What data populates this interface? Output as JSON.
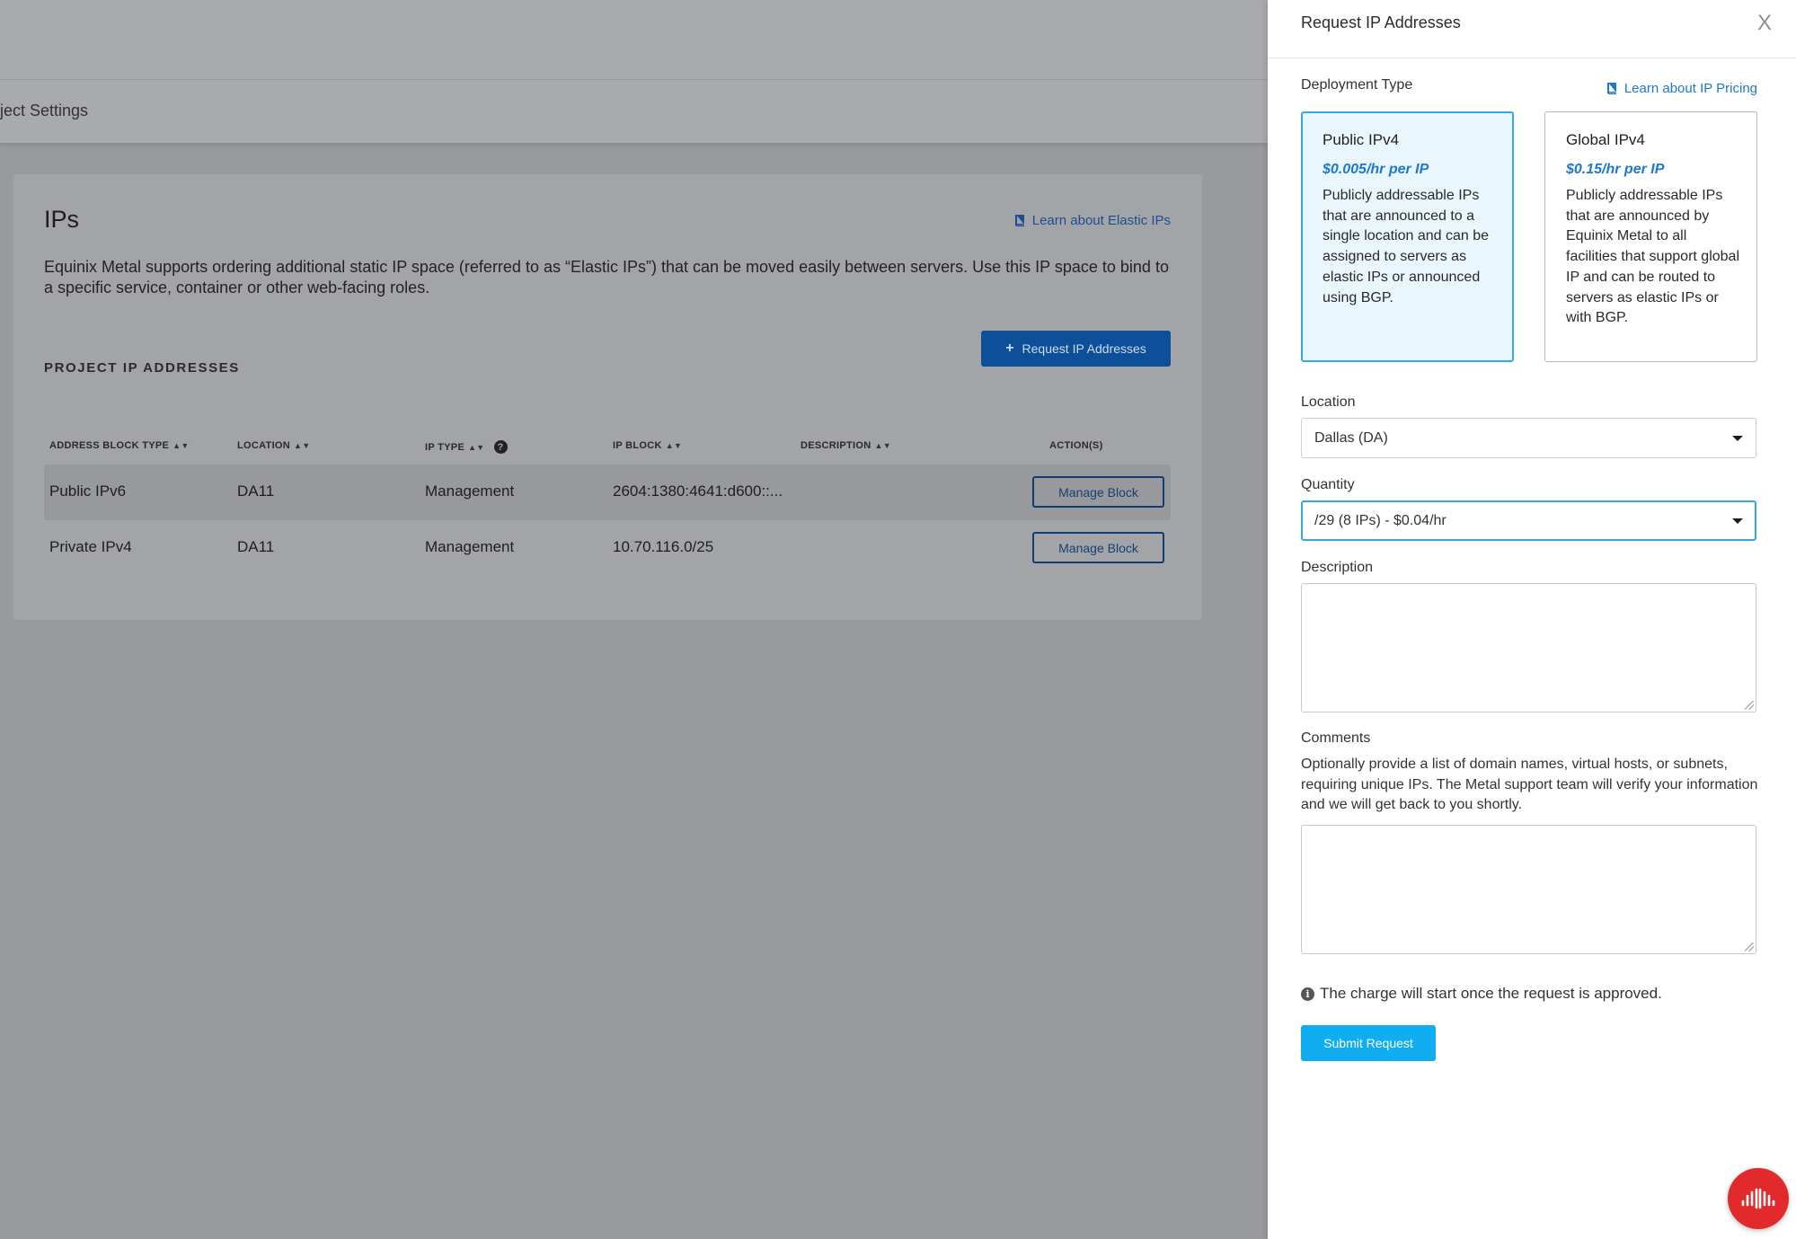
{
  "background": {
    "subnav_label": "ject Settings",
    "ips": {
      "title": "IPs",
      "learn_link": "Learn about Elastic IPs",
      "description": "Equinix Metal supports ordering additional static IP space (referred to as “Elastic IPs”) that can be moved easily between servers. Use this IP space to bind to a specific service, container or other web-facing roles.",
      "section_heading": "PROJECT IP ADDRESSES",
      "request_button": "Request IP Addresses",
      "table": {
        "headers": {
          "type": "ADDRESS BLOCK TYPE",
          "location": "LOCATION",
          "ip_type": "IP TYPE",
          "ip_block": "IP BLOCK",
          "description": "DESCRIPTION",
          "actions": "ACTION(S)"
        },
        "rows": [
          {
            "type": "Public IPv6",
            "location": "DA11",
            "ip_type": "Management",
            "ip_block": "2604:1380:4641:d600::...",
            "description": "",
            "action": "Manage Block"
          },
          {
            "type": "Private IPv4",
            "location": "DA11",
            "ip_type": "Management",
            "ip_block": "10.70.116.0/25",
            "description": "",
            "action": "Manage Block"
          }
        ]
      }
    }
  },
  "panel": {
    "title": "Request IP Addresses",
    "close_label": "X",
    "deployment_type_label": "Deployment Type",
    "pricing_link": "Learn about IP Pricing",
    "options": [
      {
        "name": "Public IPv4",
        "price": "$0.005/hr per IP",
        "description": "Publicly addressable IPs that are announced to a single location and can be assigned to servers as elastic IPs or announced using BGP.",
        "selected": true
      },
      {
        "name": "Global IPv4",
        "price": "$0.15/hr per IP",
        "description": "Publicly addressable IPs that are announced by Equinix Metal to all facilities that support global IP and can be routed to servers as elastic IPs or with BGP.",
        "selected": false
      }
    ],
    "location": {
      "label": "Location",
      "value": "Dallas (DA)"
    },
    "quantity": {
      "label": "Quantity",
      "value": "/29 (8 IPs) - $0.04/hr"
    },
    "description_field": {
      "label": "Description",
      "value": ""
    },
    "comments": {
      "label": "Comments",
      "help": "Optionally provide a list of domain names, virtual hosts, or subnets, requiring unique IPs. The Metal support team will verify your information and we will get back to you shortly.",
      "value": ""
    },
    "notice": "The charge will start once the request is approved.",
    "submit_label": "Submit Request"
  },
  "colors": {
    "accent": "#1e78c8",
    "selected_card_bg": "#e9f6fc",
    "submit_button": "#10adf0",
    "request_button": "#0d4f98",
    "logo_badge": "#e22a2d",
    "overlay": "#999a9e"
  },
  "icons": {
    "book": "book-icon",
    "close": "close-icon",
    "caret": "caret-down-icon",
    "info": "info-icon",
    "help": "help-icon",
    "plus": "plus-icon",
    "sort": "sort-icon",
    "logo": "equinix-logo-icon"
  }
}
